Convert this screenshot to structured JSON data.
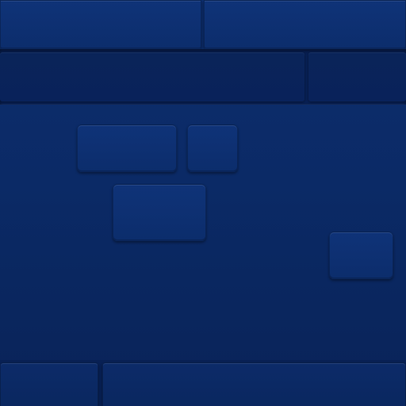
{
  "screen": {
    "background_color": "#0b2a66",
    "accent_color": "#0f3378",
    "shadow_color": "#081f52"
  },
  "top_bar": {
    "segments": 2
  },
  "band": {
    "segments": 2
  },
  "workspace": {
    "tiles": 4
  },
  "bottom_bar": {
    "segments": 2
  }
}
